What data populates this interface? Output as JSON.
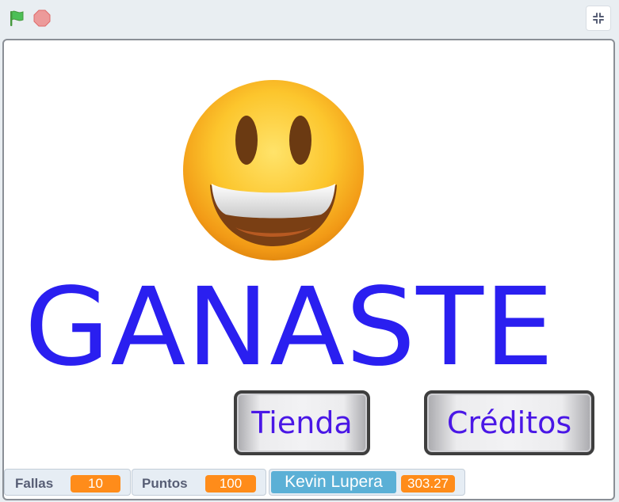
{
  "controls": {
    "green_flag_icon": "green-flag-icon",
    "stop_icon": "stop-sign-icon",
    "fullscreen_icon": "exit-fullscreen-icon"
  },
  "stage": {
    "emoji_icon": "grinning-face-icon",
    "title": "GANASTE",
    "buttons": {
      "tienda": "Tienda",
      "creditos": "Créditos"
    }
  },
  "monitors": {
    "fallas": {
      "label": "Fallas",
      "value": "10"
    },
    "puntos": {
      "label": "Puntos",
      "value": "100"
    },
    "usuario": {
      "name": "Kevin Lupera",
      "value": "303.27"
    }
  },
  "colors": {
    "title": "#2a1ff0",
    "button_text": "#4a17e6",
    "monitor_value_bg": "#ff8c1a",
    "user_bg": "#5bb0d6",
    "flag": "#4cbf56",
    "stop": "#ec5959"
  }
}
